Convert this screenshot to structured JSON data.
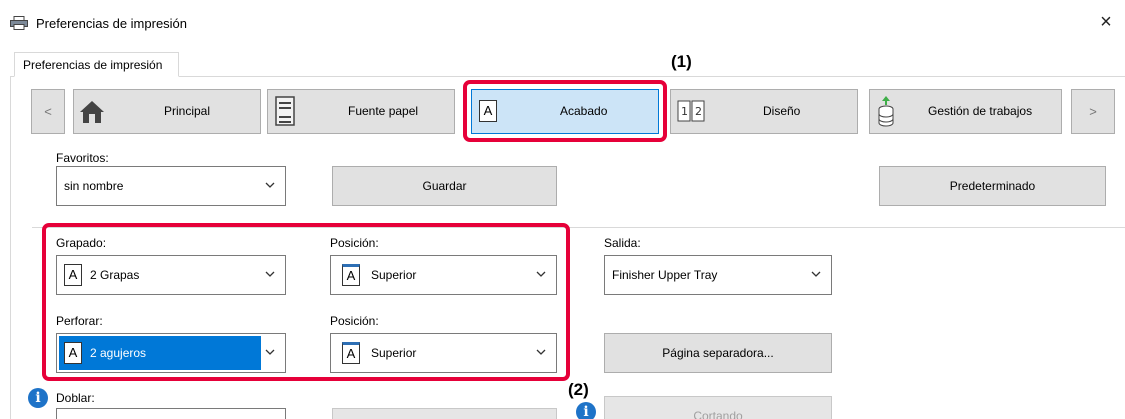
{
  "window": {
    "title": "Preferencias de impresión",
    "close_glyph": "×"
  },
  "tab": {
    "label": "Preferencias de impresión"
  },
  "nav": {
    "prev_glyph": "<",
    "next_glyph": ">",
    "items": [
      {
        "label": "Principal",
        "icon": "home-icon"
      },
      {
        "label": "Fuente papel",
        "icon": "paper-tray-icon"
      },
      {
        "label": "Acabado",
        "icon": "finishing-icon",
        "active": true
      },
      {
        "label": "Diseño",
        "icon": "layout-icon"
      },
      {
        "label": "Gestión de trabajos",
        "icon": "job-storage-icon"
      }
    ]
  },
  "favorites": {
    "label": "Favoritos:",
    "value": "sin nombre",
    "save_label": "Guardar",
    "default_label": "Predeterminado"
  },
  "stapling": {
    "label": "Grapado:",
    "value": "2 Grapas"
  },
  "staple_position": {
    "label": "Posición:",
    "value": "Superior"
  },
  "output": {
    "label": "Salida:",
    "value": "Finisher Upper Tray"
  },
  "punch": {
    "label": "Perforar:",
    "value": "2 agujeros"
  },
  "punch_position": {
    "label": "Posición:",
    "value": "Superior"
  },
  "separator_page": {
    "label": "Página separadora..."
  },
  "fold": {
    "label": "Doblar:"
  },
  "cutting": {
    "label": "Cortando"
  },
  "callouts": {
    "one": "(1)",
    "two": "(2)"
  },
  "colors": {
    "accent": "#0078d7",
    "callout": "#e60039",
    "info": "#1e73c8"
  }
}
